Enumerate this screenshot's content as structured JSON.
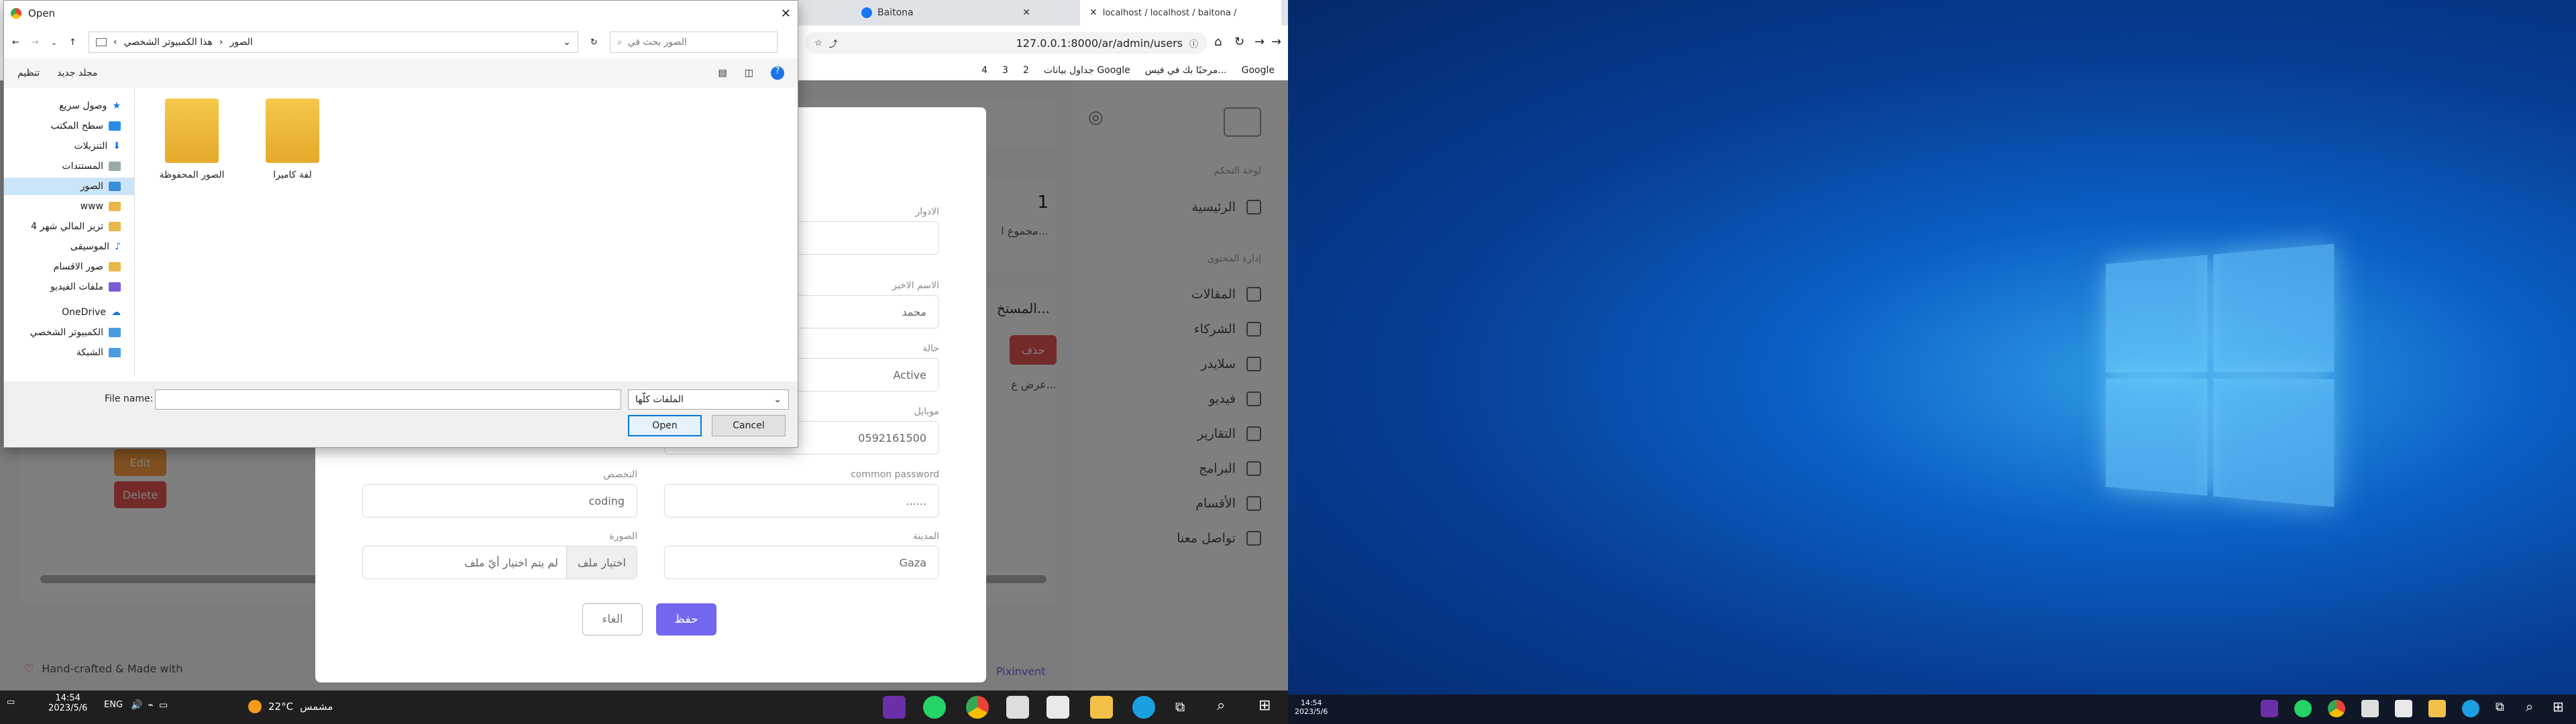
{
  "browser": {
    "tabs": [
      {
        "label": "Baitona"
      },
      {
        "label": "localhost / localhost / baitona /"
      }
    ],
    "address": "127.0.0.1:8000/ar/admin/users",
    "bookmarks": [
      "Google",
      "مرحبًا بك في فيس...",
      "جداول بيانات Google",
      "2",
      "3",
      "4"
    ]
  },
  "app": {
    "sidebar": {
      "section_dashboard": "لوحة التحكم",
      "home": "الرئيسية",
      "section_content": "إدارة المحتوى",
      "items": [
        "المقالات",
        "الشركاء",
        "سلايدر",
        "فيديو",
        "التقارير",
        "البرامج",
        "الأقسام",
        "تواصل معنا"
      ]
    },
    "stat": {
      "count": "1",
      "label": "مجموع ا..."
    },
    "section_title": "المستخ...",
    "show_label": "عرض ع...",
    "table_buttons": {
      "edit": "Edit",
      "delete": "Delete"
    },
    "footer": {
      "made_with": "Hand-crafted & Made with",
      "brand": "Pixinvent"
    },
    "danger_button": "حذف"
  },
  "modal": {
    "fields": {
      "roles": {
        "label": "الادوار",
        "value": ""
      },
      "last_name": {
        "label": "الاسم الاخير",
        "value": "محمد"
      },
      "status": {
        "label": "حالة",
        "value": "Active"
      },
      "mobile": {
        "label": "موبايل",
        "value": "0592161500"
      },
      "password": {
        "label": "common password",
        "value": "......"
      },
      "specialty": {
        "label": "التخصص",
        "value": "coding"
      },
      "city": {
        "label": "المدينة",
        "value": "Gaza"
      },
      "image": {
        "label": "الصورة",
        "button": "اختيار ملف",
        "placeholder": "لم يتم اختيار أيّ ملف"
      }
    },
    "save": "حفظ",
    "cancel": "الغاء"
  },
  "dialog": {
    "title": "Open",
    "breadcrumb": [
      "هذا الكمبيوتر الشخصي",
      "الصور"
    ],
    "search_placeholder": "الصور بحث في",
    "organize": "تنظيم",
    "new_folder": "مجلد جديد",
    "tree": [
      {
        "label": "وصول سريع",
        "expand": "v"
      },
      {
        "label": "سطح المكتب"
      },
      {
        "label": "التنزيلات"
      },
      {
        "label": "المستندات"
      },
      {
        "label": "الصور",
        "selected": true
      },
      {
        "label": "www"
      },
      {
        "label": "ترير المالي شهر 4"
      },
      {
        "label": "الموسيقى"
      },
      {
        "label": "صور الاقسام"
      },
      {
        "label": "ملفات الفيديو"
      },
      {
        "label": "OneDrive",
        "expand": ">"
      },
      {
        "label": "الكمبيوتر الشخصي",
        "expand": ">"
      },
      {
        "label": "الشبكة",
        "expand": ">"
      }
    ],
    "folders": [
      {
        "label": "لفة كاميرا"
      },
      {
        "label": "الصور المحفوظة"
      }
    ],
    "filename_label": "File name:",
    "filename_value": "",
    "filetype": "الملفات كلّها",
    "open_button": "Open",
    "cancel_button": "Cancel"
  },
  "taskbar": {
    "weather_temp": "22°C",
    "weather_text": "مشمس",
    "lang": "ENG",
    "time": "14:54",
    "date": "2023/5/6"
  }
}
